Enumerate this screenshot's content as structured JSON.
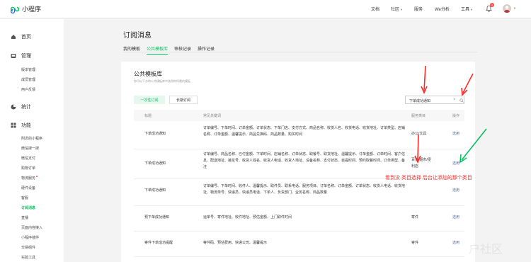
{
  "app": {
    "name": "小程序"
  },
  "topnav": {
    "docs": "文档",
    "community": "社区",
    "service": "服务",
    "analysis": "We分析",
    "tools": "工具",
    "notifications": "1"
  },
  "sidebar": {
    "home": "首页",
    "manage": "管理",
    "manage_items": [
      "版本管理",
      "成员管理",
      "用户反馈"
    ],
    "stats": "统计",
    "features": "功能",
    "feature_items": [
      "附近的小程序",
      "微信搜一搜",
      "微信支付",
      "购物订单",
      "物流服务",
      "硬件设备",
      "客服",
      "订阅消息",
      "直播",
      "页面内容接入",
      "小程序插件",
      "交易组件",
      "实验工具"
    ]
  },
  "page": {
    "title": "订阅消息",
    "tabs": [
      "我的模板",
      "公共模板库",
      "审核记录",
      "操作记录"
    ]
  },
  "library": {
    "title": "公共模板库",
    "subtitle": "你可以下方的公共模板库中选用你所需的模板",
    "btn_once": "一次性订阅",
    "btn_long": "长期订阅",
    "search_value": "下单成功通知",
    "headers": {
      "title": "标题",
      "keywords": "常见关键词",
      "category": "服务类目",
      "action": "操作"
    },
    "rows": [
      {
        "title": "下单成功通知",
        "keywords": "订单编号、下单时间、订单金额、订单状态、下单门店、支付方式、商品名称、收货人名、收货电话、收货地址、订单类型、店铺名称、订单金额、温馨提示、商品兑换码、商品数量、购买时间",
        "category": "办公/文具",
        "action": "选用"
      },
      {
        "title": "下单成功通知",
        "keywords": "订单编号、商品名称、已付金额、下单时间、店铺名称、订单状态、取餐号、取货地址、温馨提示、订单金额、订单时间、客户信息、配送地址、接龙号、收货人姓名、收货人电话、收货人地址、设备名称、支付状态、自提时间、预约取餐时间、订单类型、备注",
        "category": "百货/超市/便利店",
        "action": "选用"
      },
      {
        "title": "下单成功通知",
        "keywords": "订单编号、下单时间、收件人、温馨提示、取件员、联系电话、服务项目、订单名称、订单金额、订单状态、收货人电话、收货地址、物流单号、快递员、快递员电话、下单人、负责部门、业务名称、商品数量",
        "category": "",
        "action": "选用"
      },
      {
        "title": "预下单成功通知",
        "keywords": "运单号、寄件地址、收件地址、预估金额、上门取件时间",
        "category": "寄件",
        "action": "选用"
      },
      {
        "title": "寄件下单成功提醒",
        "keywords": "寄件码、预估费用、快递公司、温馨提示",
        "category": "寄件",
        "action": "选用"
      }
    ]
  },
  "annotation": {
    "text": "看到没 类目选择 后台让添加的那个类目"
  },
  "watermark": "户社区",
  "colors": {
    "brand_green": "#07c160",
    "link": "#576b95",
    "annotation_red": "#fa2c2c"
  }
}
